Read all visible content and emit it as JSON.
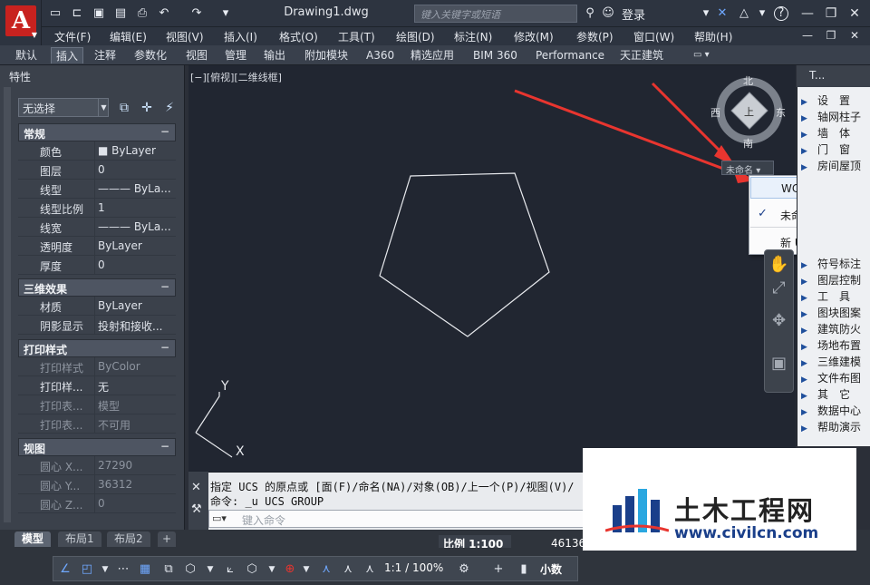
{
  "app": {
    "doc_title": "Drawing1.dwg",
    "search_placeholder": "键入关键字或短语",
    "login": "登录",
    "help": "?"
  },
  "menus": [
    "文件(F)",
    "编辑(E)",
    "视图(V)",
    "插入(I)",
    "格式(O)",
    "工具(T)",
    "绘图(D)",
    "标注(N)",
    "修改(M)",
    "参数(P)",
    "窗口(W)",
    "帮助(H)"
  ],
  "ribbon_tabs": [
    "默认",
    "插入",
    "注释",
    "参数化",
    "视图",
    "管理",
    "输出",
    "附加模块",
    "A360",
    "精选应用",
    "BIM 360",
    "Performance",
    "天正建筑"
  ],
  "active_ribbon_tab": "插入",
  "properties": {
    "title": "特性",
    "selection": "无选择",
    "sections": [
      {
        "name": "常规",
        "rows": [
          {
            "k": "颜色",
            "v": "■ ByLayer"
          },
          {
            "k": "图层",
            "v": "0"
          },
          {
            "k": "线型",
            "v": "——— ByLa..."
          },
          {
            "k": "线型比例",
            "v": "1"
          },
          {
            "k": "线宽",
            "v": "——— ByLa..."
          },
          {
            "k": "透明度",
            "v": "ByLayer"
          },
          {
            "k": "厚度",
            "v": "0"
          }
        ]
      },
      {
        "name": "三维效果",
        "rows": [
          {
            "k": "材质",
            "v": "ByLayer"
          },
          {
            "k": "阴影显示",
            "v": "投射和接收..."
          }
        ]
      },
      {
        "name": "打印样式",
        "rows": [
          {
            "k": "打印样式",
            "v": "ByColor",
            "dim": true
          },
          {
            "k": "打印样...",
            "v": "无"
          },
          {
            "k": "打印表...",
            "v": "模型",
            "dim": true
          },
          {
            "k": "打印表...",
            "v": "不可用",
            "dim": true
          }
        ]
      },
      {
        "name": "视图",
        "rows": [
          {
            "k": "圆心 X...",
            "v": "27290",
            "dim": true
          },
          {
            "k": "圆心 Y...",
            "v": "36312",
            "dim": true
          },
          {
            "k": "圆心 Z...",
            "v": "0",
            "dim": true
          }
        ]
      }
    ]
  },
  "viewport": {
    "label": "[−][俯视][二维线框]",
    "ucs_axis_x": "X",
    "ucs_axis_y": "Y"
  },
  "viewcube": {
    "north": "北",
    "south": "南",
    "east": "东",
    "west": "西",
    "top_face": "上",
    "ucs_name": "未命名"
  },
  "ucs_menu": [
    {
      "label": "WCS",
      "checked": false,
      "highlighted": true
    },
    {
      "label": "未命名",
      "checked": true,
      "highlighted": false
    },
    {
      "label": "新 UCS",
      "checked": false,
      "highlighted": false
    }
  ],
  "tool_palette": {
    "title": "T...",
    "items": [
      "设　置",
      "轴网柱子",
      "墙　体",
      "门　窗",
      "房间屋顶",
      "符号标注",
      "图层控制",
      "工　具",
      "图块图案",
      "建筑防火",
      "场地布置",
      "三维建模",
      "文件布图",
      "其　它",
      "数据中心",
      "帮助演示"
    ]
  },
  "command": {
    "line1": "指定 UCS 的原点或 [面(F)/命名(NA)/对象(OB)/上一个(P)/视图(V)/",
    "line2": "命令: _u UCS GROUP",
    "input_placeholder": "键入命令"
  },
  "layout_tabs": [
    "模型",
    "布局1",
    "布局2"
  ],
  "active_layout_tab": "模型",
  "status": {
    "scale": "比例 1:100",
    "coord": "46136",
    "zoom": "1:1 / 100%",
    "units": "小数"
  },
  "watermark": {
    "title": "土木工程网",
    "url": "www.civilcn.com"
  },
  "colors": {
    "canvas": "#212631",
    "accent_red": "#e8352f",
    "logo_red": "#c8221f"
  }
}
